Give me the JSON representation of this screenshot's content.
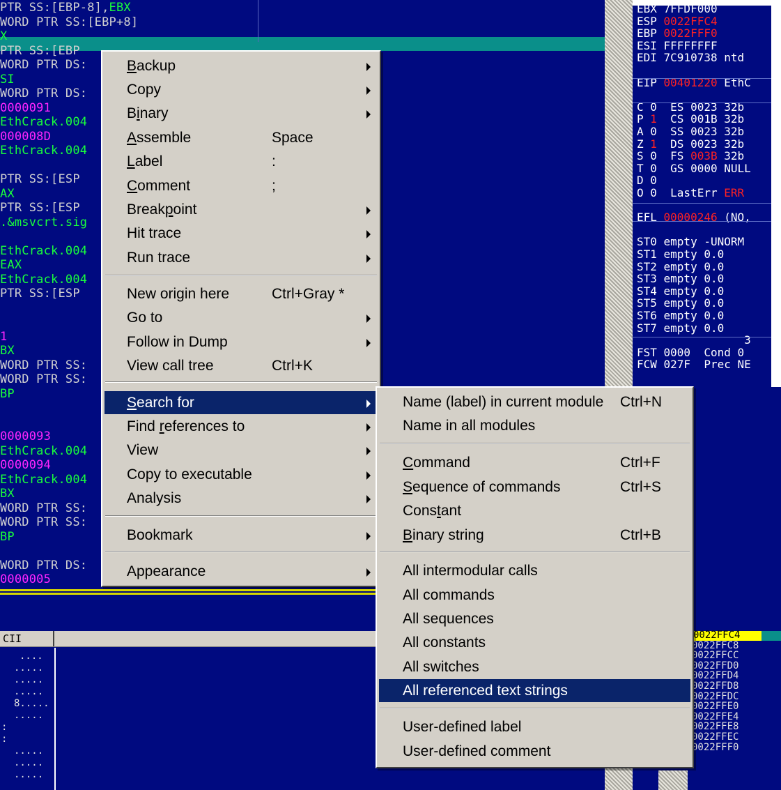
{
  "code_pane": {
    "lines": [
      {
        "t": "PTR SS:[EBP-8],",
        "c": "c-grey",
        "extra": "EBX",
        "extra_c": "c-green"
      },
      {
        "t": "WORD PTR SS:[EBP+8]",
        "c": "c-grey"
      },
      {
        "t": "X",
        "c": "c-green"
      },
      {
        "t": "PTR SS:[EBP",
        "c": "c-grey"
      },
      {
        "t": "WORD PTR DS:",
        "c": "c-grey"
      },
      {
        "t": "SI",
        "c": "c-green"
      },
      {
        "t": "WORD PTR DS:",
        "c": "c-grey"
      },
      {
        "t": "0000091",
        "c": "c-mag"
      },
      {
        "t": "EthCrack.004",
        "c": "c-green"
      },
      {
        "t": "000008D",
        "c": "c-mag"
      },
      {
        "t": "EthCrack.004",
        "c": "c-green"
      },
      {
        "t": "",
        "c": "c-grey"
      },
      {
        "t": "PTR SS:[ESP",
        "c": "c-grey"
      },
      {
        "t": "AX",
        "c": "c-green"
      },
      {
        "t": "PTR SS:[ESP",
        "c": "c-grey"
      },
      {
        "t": ".&msvcrt.sig",
        "c": "c-green"
      },
      {
        "t": "",
        "c": "c-grey"
      },
      {
        "t": "EthCrack.004",
        "c": "c-green"
      },
      {
        "t": "EAX",
        "c": "c-green"
      },
      {
        "t": "EthCrack.004",
        "c": "c-green"
      },
      {
        "t": "PTR SS:[ESP",
        "c": "c-grey"
      },
      {
        "t": "",
        "c": "c-grey"
      },
      {
        "t": "",
        "c": "c-grey"
      },
      {
        "t": "1",
        "c": "c-mag"
      },
      {
        "t": "BX",
        "c": "c-green"
      },
      {
        "t": "WORD PTR SS:",
        "c": "c-grey"
      },
      {
        "t": "WORD PTR SS:",
        "c": "c-grey"
      },
      {
        "t": "BP",
        "c": "c-green"
      },
      {
        "t": "",
        "c": "c-grey"
      },
      {
        "t": "",
        "c": "c-grey"
      },
      {
        "t": "0000093",
        "c": "c-mag"
      },
      {
        "t": "EthCrack.004",
        "c": "c-green"
      },
      {
        "t": "0000094",
        "c": "c-mag"
      },
      {
        "t": "EthCrack.004",
        "c": "c-green"
      },
      {
        "t": "BX",
        "c": "c-green"
      },
      {
        "t": "WORD PTR SS:",
        "c": "c-grey"
      },
      {
        "t": "WORD PTR SS:",
        "c": "c-grey"
      },
      {
        "t": "BP",
        "c": "c-green"
      },
      {
        "t": "",
        "c": "c-grey"
      },
      {
        "t": "WORD PTR DS:",
        "c": "c-grey"
      },
      {
        "t": "0000005",
        "c": "c-mag"
      }
    ]
  },
  "registers": {
    "lines": [
      [
        {
          "t": "EBX 7FFDF000",
          "c": "c-white"
        }
      ],
      [
        {
          "t": "ESP ",
          "c": "c-white"
        },
        {
          "t": "0022FFC4",
          "c": "c-red"
        }
      ],
      [
        {
          "t": "EBP ",
          "c": "c-white"
        },
        {
          "t": "0022FFF0",
          "c": "c-red"
        }
      ],
      [
        {
          "t": "ESI FFFFFFFF",
          "c": "c-white"
        }
      ],
      [
        {
          "t": "EDI 7C910738 ntd",
          "c": "c-white"
        }
      ],
      [
        {
          "t": "",
          "c": "c-white"
        }
      ],
      [
        {
          "t": "EIP ",
          "c": "c-white"
        },
        {
          "t": "00401220",
          "c": "c-red"
        },
        {
          "t": " EthC",
          "c": "c-white"
        }
      ],
      [
        {
          "t": "",
          "c": "c-white"
        }
      ],
      [
        {
          "t": "C 0  ES 0023 32b",
          "c": "c-white"
        }
      ],
      [
        {
          "t": "P ",
          "c": "c-white"
        },
        {
          "t": "1",
          "c": "c-red"
        },
        {
          "t": "  CS 001B 32b",
          "c": "c-white"
        }
      ],
      [
        {
          "t": "A 0  SS 0023 32b",
          "c": "c-white"
        }
      ],
      [
        {
          "t": "Z ",
          "c": "c-white"
        },
        {
          "t": "1",
          "c": "c-red"
        },
        {
          "t": "  DS 0023 32b",
          "c": "c-white"
        }
      ],
      [
        {
          "t": "S 0  FS ",
          "c": "c-white"
        },
        {
          "t": "003B",
          "c": "c-red"
        },
        {
          "t": " 32b",
          "c": "c-white"
        }
      ],
      [
        {
          "t": "T 0  GS 0000 NULL",
          "c": "c-white"
        }
      ],
      [
        {
          "t": "D 0",
          "c": "c-white"
        }
      ],
      [
        {
          "t": "O 0  LastErr ",
          "c": "c-white"
        },
        {
          "t": "ERR",
          "c": "c-red"
        }
      ],
      [
        {
          "t": "",
          "c": "c-white"
        }
      ],
      [
        {
          "t": "EFL ",
          "c": "c-white"
        },
        {
          "t": "00000246",
          "c": "c-red"
        },
        {
          "t": " (NO,",
          "c": "c-white"
        }
      ],
      [
        {
          "t": "",
          "c": "c-white"
        }
      ],
      [
        {
          "t": "ST0 empty -UNORM",
          "c": "c-white"
        }
      ],
      [
        {
          "t": "ST1 empty 0.0",
          "c": "c-white"
        }
      ],
      [
        {
          "t": "ST2 empty 0.0",
          "c": "c-white"
        }
      ],
      [
        {
          "t": "ST3 empty 0.0",
          "c": "c-white"
        }
      ],
      [
        {
          "t": "ST4 empty 0.0",
          "c": "c-white"
        }
      ],
      [
        {
          "t": "ST5 empty 0.0",
          "c": "c-white"
        }
      ],
      [
        {
          "t": "ST6 empty 0.0",
          "c": "c-white"
        }
      ],
      [
        {
          "t": "ST7 empty 0.0",
          "c": "c-white"
        }
      ],
      [
        {
          "t": "                3",
          "c": "c-white"
        }
      ],
      [
        {
          "t": "FST 0000  Cond 0",
          "c": "c-white"
        }
      ],
      [
        {
          "t": "FCW 027F  Prec NE",
          "c": "c-white"
        }
      ]
    ]
  },
  "dump_pane": {
    "header_label": "CII",
    "rows": [
      "....",
      ".....",
      ".....",
      ".....",
      "8.....",
      ".....",
      ":",
      ":",
      ".....",
      ".....",
      "....."
    ]
  },
  "stack_pane": {
    "rows": [
      "0022FFC4",
      "0022FFC8",
      "0022FFCC",
      "0022FFD0",
      "0022FFD4",
      "0022FFD8",
      "0022FFDC",
      "0022FFE0",
      "0022FFE4",
      "0022FFE8",
      "0022FFEC",
      "0022FFF0"
    ]
  },
  "main_menu": {
    "items": [
      {
        "pre": "",
        "u": "B",
        "post": "ackup",
        "shortcut": "",
        "submenu": true
      },
      {
        "pre": "Copy",
        "u": "",
        "post": "",
        "shortcut": "",
        "submenu": true
      },
      {
        "pre": "B",
        "u": "i",
        "post": "nary",
        "shortcut": "",
        "submenu": true
      },
      {
        "pre": "",
        "u": "A",
        "post": "ssemble",
        "shortcut": "Space",
        "submenu": false
      },
      {
        "pre": "",
        "u": "L",
        "post": "abel",
        "shortcut": ":",
        "submenu": false
      },
      {
        "pre": "",
        "u": "C",
        "post": "omment",
        "shortcut": ";",
        "submenu": false
      },
      {
        "pre": "Break",
        "u": "p",
        "post": "oint",
        "shortcut": "",
        "submenu": true
      },
      {
        "pre": "Hit trace",
        "u": "",
        "post": "",
        "shortcut": "",
        "submenu": true
      },
      {
        "pre": "Run trace",
        "u": "",
        "post": "",
        "shortcut": "",
        "submenu": true
      },
      {
        "pre": "New origin here",
        "u": "",
        "post": "",
        "shortcut": "Ctrl+Gray *",
        "submenu": false
      },
      {
        "pre": "Go to",
        "u": "",
        "post": "",
        "shortcut": "",
        "submenu": true
      },
      {
        "pre": "Follow in Dump",
        "u": "",
        "post": "",
        "shortcut": "",
        "submenu": true
      },
      {
        "pre": "View call tree",
        "u": "",
        "post": "",
        "shortcut": "Ctrl+K",
        "submenu": false
      },
      {
        "pre": "",
        "u": "S",
        "post": "earch for",
        "shortcut": "",
        "submenu": true,
        "selected": true
      },
      {
        "pre": "Find ",
        "u": "r",
        "post": "eferences to",
        "shortcut": "",
        "submenu": true
      },
      {
        "pre": "View",
        "u": "",
        "post": "",
        "shortcut": "",
        "submenu": true
      },
      {
        "pre": "Copy to executable",
        "u": "",
        "post": "",
        "shortcut": "",
        "submenu": true
      },
      {
        "pre": "Analysis",
        "u": "",
        "post": "",
        "shortcut": "",
        "submenu": true
      },
      {
        "pre": "Bookmark",
        "u": "",
        "post": "",
        "shortcut": "",
        "submenu": true
      },
      {
        "pre": "Appearance",
        "u": "",
        "post": "",
        "shortcut": "",
        "submenu": true
      }
    ]
  },
  "sub_menu": {
    "items": [
      {
        "pre": "Name (label) in current module",
        "u": "",
        "post": "",
        "shortcut": "Ctrl+N"
      },
      {
        "pre": "Name in all modules",
        "u": "",
        "post": "",
        "shortcut": ""
      },
      {
        "pre": "",
        "u": "C",
        "post": "ommand",
        "shortcut": "Ctrl+F"
      },
      {
        "pre": "",
        "u": "S",
        "post": "equence of commands",
        "shortcut": "Ctrl+S"
      },
      {
        "pre": "Cons",
        "u": "t",
        "post": "ant",
        "shortcut": ""
      },
      {
        "pre": "",
        "u": "B",
        "post": "inary string",
        "shortcut": "Ctrl+B"
      },
      {
        "pre": "All intermodular calls",
        "u": "",
        "post": "",
        "shortcut": ""
      },
      {
        "pre": "All commands",
        "u": "",
        "post": "",
        "shortcut": ""
      },
      {
        "pre": "All sequences",
        "u": "",
        "post": "",
        "shortcut": ""
      },
      {
        "pre": "All constants",
        "u": "",
        "post": "",
        "shortcut": ""
      },
      {
        "pre": "All switches",
        "u": "",
        "post": "",
        "shortcut": ""
      },
      {
        "pre": "All referenced text strings",
        "u": "",
        "post": "",
        "shortcut": "",
        "selected": true
      },
      {
        "pre": "User-defined label",
        "u": "",
        "post": "",
        "shortcut": ""
      },
      {
        "pre": "User-defined comment",
        "u": "",
        "post": "",
        "shortcut": ""
      }
    ]
  },
  "colors": {
    "pane_bg": "#000a80",
    "menu_bg": "#d4d0c8",
    "menu_highlight": "#0a246a",
    "code_green": "#19ff3b",
    "code_magenta": "#ff25ff",
    "reg_red": "#ff2222",
    "stack_selected": "#ffff00",
    "current_line": "#0a8f8a"
  }
}
